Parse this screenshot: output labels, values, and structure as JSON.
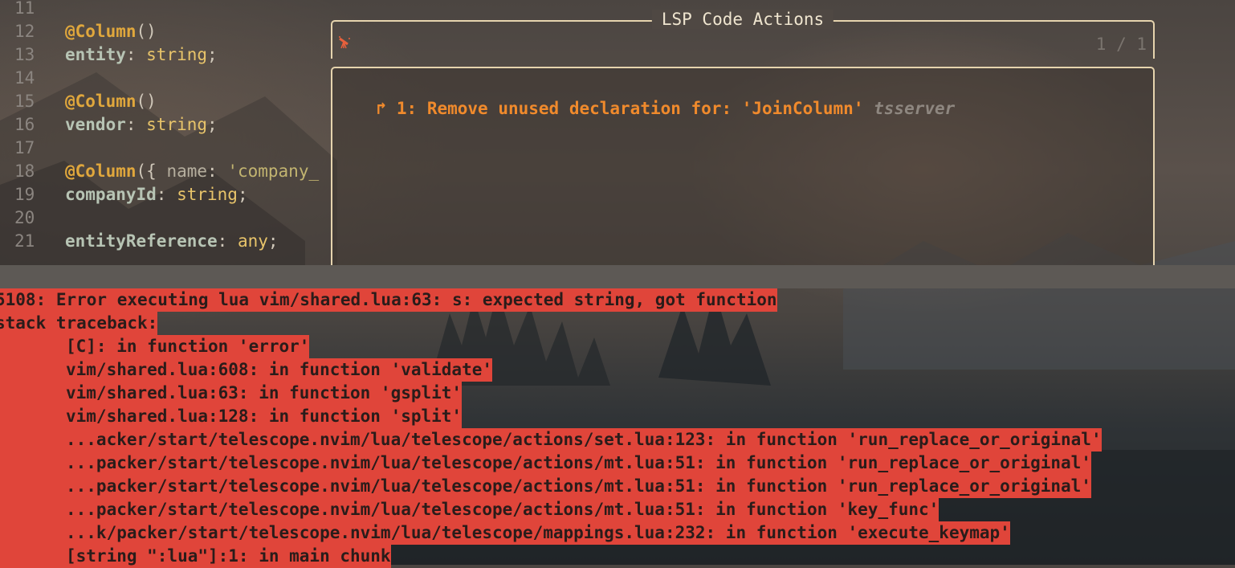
{
  "editor": {
    "lines": [
      {
        "num": "11",
        "parts": []
      },
      {
        "num": "12",
        "parts": [
          {
            "t": "@Column",
            "c": "dec"
          },
          {
            "t": "()",
            "c": "punct"
          }
        ]
      },
      {
        "num": "13",
        "parts": [
          {
            "t": "entity",
            "c": "ident"
          },
          {
            "t": ": ",
            "c": "punct"
          },
          {
            "t": "string",
            "c": "type"
          },
          {
            "t": ";",
            "c": "punct"
          }
        ]
      },
      {
        "num": "14",
        "parts": []
      },
      {
        "num": "15",
        "parts": [
          {
            "t": "@Column",
            "c": "dec"
          },
          {
            "t": "()",
            "c": "punct"
          }
        ]
      },
      {
        "num": "16",
        "parts": [
          {
            "t": "vendor",
            "c": "ident"
          },
          {
            "t": ": ",
            "c": "punct"
          },
          {
            "t": "string",
            "c": "type"
          },
          {
            "t": ";",
            "c": "punct"
          }
        ]
      },
      {
        "num": "17",
        "parts": []
      },
      {
        "num": "18",
        "parts": [
          {
            "t": "@Column",
            "c": "dec"
          },
          {
            "t": "({ ",
            "c": "punct"
          },
          {
            "t": "name",
            "c": "prop"
          },
          {
            "t": ": ",
            "c": "punct"
          },
          {
            "t": "'company_",
            "c": "str"
          }
        ]
      },
      {
        "num": "19",
        "parts": [
          {
            "t": "companyId",
            "c": "ident"
          },
          {
            "t": ": ",
            "c": "punct"
          },
          {
            "t": "string",
            "c": "type"
          },
          {
            "t": ";",
            "c": "punct"
          }
        ]
      },
      {
        "num": "20",
        "parts": []
      },
      {
        "num": "21",
        "parts": [
          {
            "t": "entityReference",
            "c": "ident"
          },
          {
            "t": ": ",
            "c": "punct"
          },
          {
            "t": "any",
            "c": "type"
          },
          {
            "t": ";",
            "c": "punct"
          }
        ]
      }
    ]
  },
  "lsp": {
    "title": "LSP Code Actions",
    "prompt_icon": "telescope-icon",
    "counter": "1 / 1",
    "items": [
      {
        "arrow": "↱",
        "label": "1: Remove unused declaration for: 'JoinColumn'",
        "server": "tsserver"
      }
    ]
  },
  "errors": {
    "lines": [
      {
        "text": "5108: Error executing lua vim/shared.lua:63: s: expected string, got function",
        "indent": false
      },
      {
        "text": "stack traceback:",
        "indent": false
      },
      {
        "text": "[C]: in function 'error'",
        "indent": true
      },
      {
        "text": "vim/shared.lua:608: in function 'validate'",
        "indent": true
      },
      {
        "text": "vim/shared.lua:63: in function 'gsplit'",
        "indent": true
      },
      {
        "text": "vim/shared.lua:128: in function 'split'",
        "indent": true
      },
      {
        "text": "...acker/start/telescope.nvim/lua/telescope/actions/set.lua:123: in function 'run_replace_or_original'",
        "indent": true
      },
      {
        "text": "...packer/start/telescope.nvim/lua/telescope/actions/mt.lua:51: in function 'run_replace_or_original'",
        "indent": true
      },
      {
        "text": "...packer/start/telescope.nvim/lua/telescope/actions/mt.lua:51: in function 'run_replace_or_original'",
        "indent": true
      },
      {
        "text": "...packer/start/telescope.nvim/lua/telescope/actions/mt.lua:51: in function 'key_func'",
        "indent": true
      },
      {
        "text": "...k/packer/start/telescope.nvim/lua/telescope/mappings.lua:232: in function 'execute_keymap'",
        "indent": true
      },
      {
        "text": "[string \":lua\"]:1: in main chunk",
        "indent": true
      }
    ]
  },
  "colors": {
    "error_bg": "#e0453a",
    "lsp_border": "#e6d4ae",
    "lsp_item": "#f08a2c",
    "decorator": "#e0a73c"
  }
}
